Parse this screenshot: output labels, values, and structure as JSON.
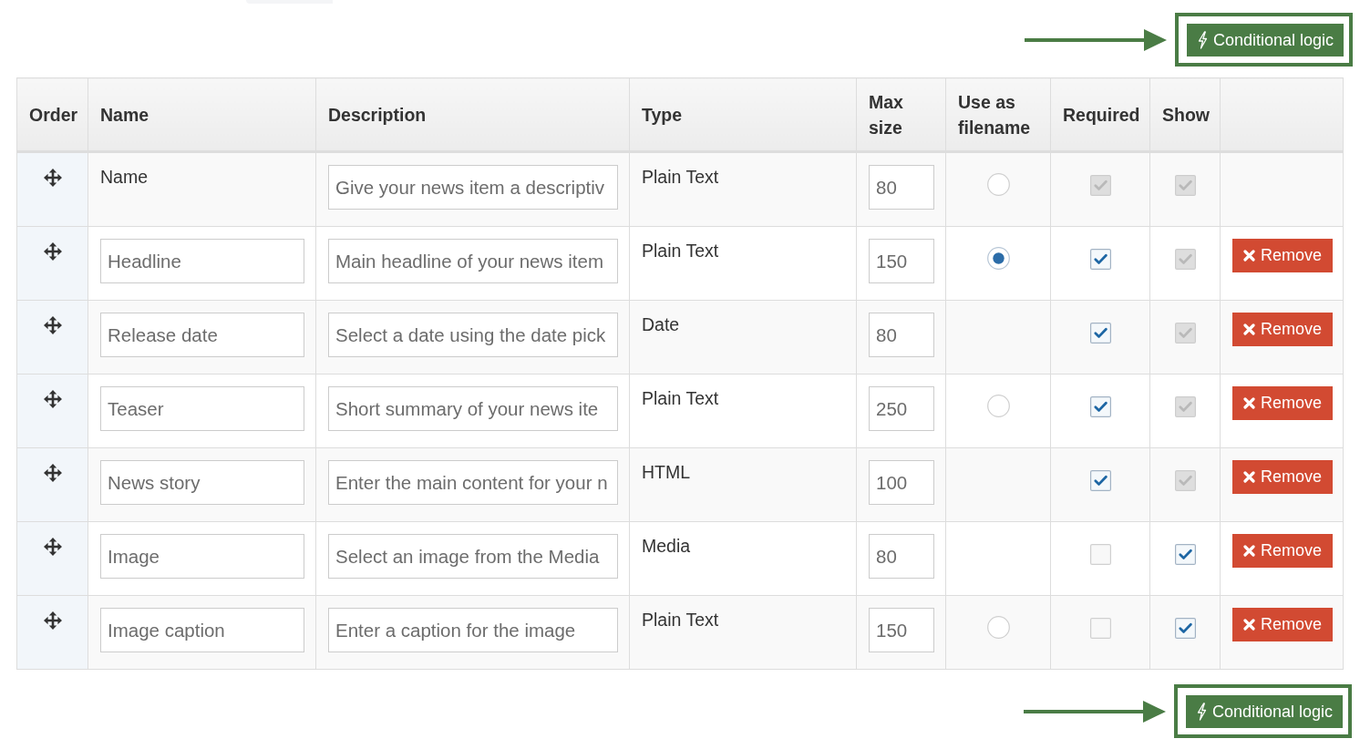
{
  "conditional_logic_top": {
    "label": "Conditional logic",
    "highlighted": true
  },
  "table": {
    "columns": [
      "Order",
      "Name",
      "Description",
      "Type",
      "Max size",
      "Use as filename",
      "Required",
      "Show"
    ],
    "rows": [
      {
        "name": {
          "kind": "label",
          "value": "Name"
        },
        "description": "Give your news item a descriptiv",
        "type": "Plain Text",
        "max_size": "80",
        "use_as_filename": {
          "selected": false
        },
        "required": {
          "checked": true,
          "disabled": true
        },
        "show": {
          "checked": true,
          "disabled": true
        }
      },
      {
        "name": {
          "kind": "input",
          "value": "Headline"
        },
        "description": "Main headline of your news item",
        "type": "Plain Text",
        "max_size": "150",
        "use_as_filename": {
          "selected": true
        },
        "required": {
          "checked": true,
          "disabled": false
        },
        "show": {
          "checked": true,
          "disabled": true
        },
        "remove": "Remove"
      },
      {
        "name": {
          "kind": "input",
          "value": "Release date"
        },
        "description": "Select a date using the date pick",
        "type": "Date",
        "max_size": "80",
        "required": {
          "checked": true,
          "disabled": false
        },
        "show": {
          "checked": true,
          "disabled": true
        },
        "remove": "Remove"
      },
      {
        "name": {
          "kind": "input",
          "value": "Teaser"
        },
        "description": "Short summary of your news ite",
        "type": "Plain Text",
        "max_size": "250",
        "use_as_filename": {
          "selected": false
        },
        "required": {
          "checked": true,
          "disabled": false
        },
        "show": {
          "checked": true,
          "disabled": true
        },
        "remove": "Remove"
      },
      {
        "name": {
          "kind": "input",
          "value": "News story"
        },
        "description": "Enter the main content for your n",
        "type": "HTML",
        "max_size": "100",
        "required": {
          "checked": true,
          "disabled": false
        },
        "show": {
          "checked": true,
          "disabled": true
        },
        "remove": "Remove"
      },
      {
        "name": {
          "kind": "input",
          "value": "Image"
        },
        "description": "Select an image from the Media",
        "type": "Media",
        "max_size": "80",
        "required": {
          "checked": false,
          "disabled": false
        },
        "show": {
          "checked": true,
          "disabled": false
        },
        "remove": "Remove"
      },
      {
        "name": {
          "kind": "input",
          "value": "Image caption"
        },
        "description": "Enter a caption for the image",
        "type": "Plain Text",
        "max_size": "150",
        "use_as_filename": {
          "selected": false
        },
        "required": {
          "checked": false,
          "disabled": false
        },
        "show": {
          "checked": true,
          "disabled": false
        },
        "remove": "Remove"
      }
    ]
  },
  "conditional_logic_bottom": {
    "label": "Conditional logic",
    "highlighted": true
  }
}
